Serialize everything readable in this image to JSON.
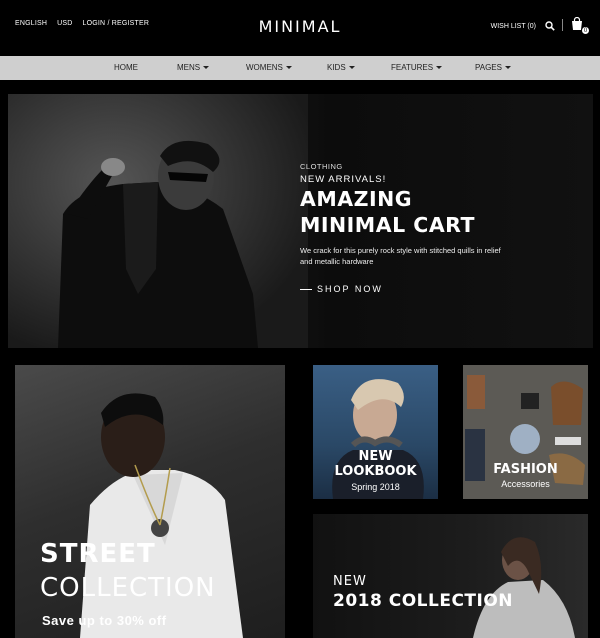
{
  "topbar": {
    "language": "ENGLISH",
    "currency": "USD",
    "login": "LOGIN / REGISTER",
    "brand": "MINIMAL",
    "wishlist": "WISH LIST (0)",
    "cart_count": "0"
  },
  "nav": {
    "items": [
      {
        "label": "HOME",
        "dropdown": false
      },
      {
        "label": "MENS",
        "dropdown": true
      },
      {
        "label": "WOMENS",
        "dropdown": true
      },
      {
        "label": "KIDS",
        "dropdown": true
      },
      {
        "label": "FEATURES",
        "dropdown": true
      },
      {
        "label": "PAGES",
        "dropdown": true
      }
    ]
  },
  "hero": {
    "category": "CLOTHING",
    "subtitle": "NEW ARRIVALS!",
    "title_line1": "AMAZING",
    "title_line2": "MINIMAL CART",
    "description": "We crack for this purely rock style with stitched quills in relief and metallic hardware",
    "cta": "SHOP NOW"
  },
  "banners": {
    "street": {
      "line1": "STREET",
      "line2": "COLLECTION",
      "line3": "Save up to 30% off"
    },
    "lookbook": {
      "line1": "NEW",
      "line2": "LOOKBOOK",
      "line3": "Spring 2018"
    },
    "fashion": {
      "line1": "FASHION",
      "line2": "Accessories"
    },
    "collection": {
      "line1": "NEW",
      "line2": "2018 COLLECTION"
    }
  },
  "colors": {
    "background": "#000000",
    "navbar": "#cfcfcf",
    "text": "#ffffff"
  },
  "icons": [
    "search-icon",
    "shopping-bag-icon",
    "caret-down-icon"
  ]
}
